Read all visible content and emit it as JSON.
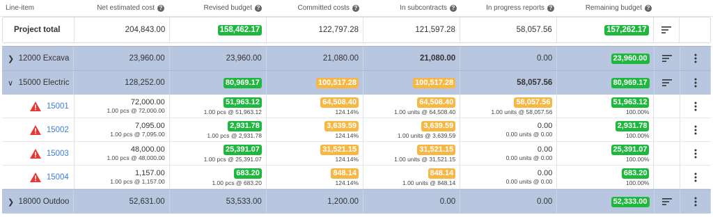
{
  "columns": {
    "line_item": "Line-item",
    "net_estimated": "Net estimated cost",
    "revised_budget": "Revised budget",
    "committed": "Committed costs",
    "subcontracts": "In subcontracts",
    "progress": "In progress reports",
    "remaining": "Remaining budget"
  },
  "project_total": {
    "label": "Project total",
    "net_estimated": "204,843.00",
    "revised_budget": "158,462.17",
    "committed": "122,797.28",
    "subcontracts": "121,597.28",
    "progress": "58,057.56",
    "remaining": "157,262.17"
  },
  "groups": [
    {
      "label": "12000 Excava",
      "net_estimated": "23,960.00",
      "revised_budget": "23,960.00",
      "committed": "21,080.00",
      "subcontracts": "21,080.00",
      "progress": "0.00",
      "remaining": "23,960.00"
    },
    {
      "label": "15000 Electric",
      "net_estimated": "128,252.00",
      "revised_budget": "80,969.17",
      "committed": "100,517.28",
      "subcontracts": "100,517.28",
      "progress": "58,057.56",
      "remaining": "80,969.17"
    },
    {
      "label": "18000 Outdoo",
      "net_estimated": "52,631.00",
      "revised_budget": "53,533.00",
      "committed": "1,200.00",
      "subcontracts": "0.00",
      "progress": "0.00",
      "remaining": "52,333.00"
    }
  ],
  "items": [
    {
      "code": "15001",
      "net_estimated": "72,000.00",
      "net_sub": "1.00 pcs @ 72,000.00",
      "revised_budget": "51,963.12",
      "revised_sub": "1.00 pcs @ 51,963.12",
      "committed": "64,508.40",
      "committed_sub": "124.14%",
      "subcontracts": "64,508.40",
      "subcontracts_sub": "1.00 units @ 64,508.40",
      "progress": "58,057.56",
      "progress_sub": "1.00 units @ 58,057.56",
      "remaining": "51,963.12",
      "remaining_sub": "100.00%"
    },
    {
      "code": "15002",
      "net_estimated": "7,095.00",
      "net_sub": "1.00 pcs @ 7,095.00",
      "revised_budget": "2,931.78",
      "revised_sub": "1.00 pcs @ 2,931.78",
      "committed": "3,639.59",
      "committed_sub": "124.14%",
      "subcontracts": "3,639.59",
      "subcontracts_sub": "1.00 units @ 3,639.59",
      "progress": "0.00",
      "progress_sub": "0.00 units @ 0.00",
      "remaining": "2,931.78",
      "remaining_sub": "100.00%"
    },
    {
      "code": "15003",
      "net_estimated": "48,000.00",
      "net_sub": "1.00 pcs @ 48,000.00",
      "revised_budget": "25,391.07",
      "revised_sub": "1.00 pcs @ 25,391.07",
      "committed": "31,521.15",
      "committed_sub": "124.14%",
      "subcontracts": "31,521.15",
      "subcontracts_sub": "1.00 units @ 31,521.15",
      "progress": "0.00",
      "progress_sub": "0.00 units @ 0.00",
      "remaining": "25,391.07",
      "remaining_sub": "100.00%"
    },
    {
      "code": "15004",
      "net_estimated": "1,157.00",
      "net_sub": "1.00 pcs @ 1,157.00",
      "revised_budget": "683.20",
      "revised_sub": "1.00 pcs @ 683.20",
      "committed": "848.14",
      "committed_sub": "124.14%",
      "subcontracts": "848.14",
      "subcontracts_sub": "1.00 units @ 848.14",
      "progress": "0.00",
      "progress_sub": "0.00 units @ 0.00",
      "remaining": "683.20",
      "remaining_sub": "100.00%"
    }
  ],
  "icons": {
    "help": "help-circle-icon",
    "sort": "sort-lines-icon",
    "more": "kebab-menu-icon",
    "warning": "warning-triangle-icon",
    "chevron_right": "chevron-right-icon",
    "chevron_down": "chevron-down-icon"
  },
  "colors": {
    "green_badge": "#1fb83f",
    "orange_badge": "#f6b744",
    "group_row": "#b8c6e0",
    "link": "#3b7ddd",
    "warning": "#e53935"
  }
}
